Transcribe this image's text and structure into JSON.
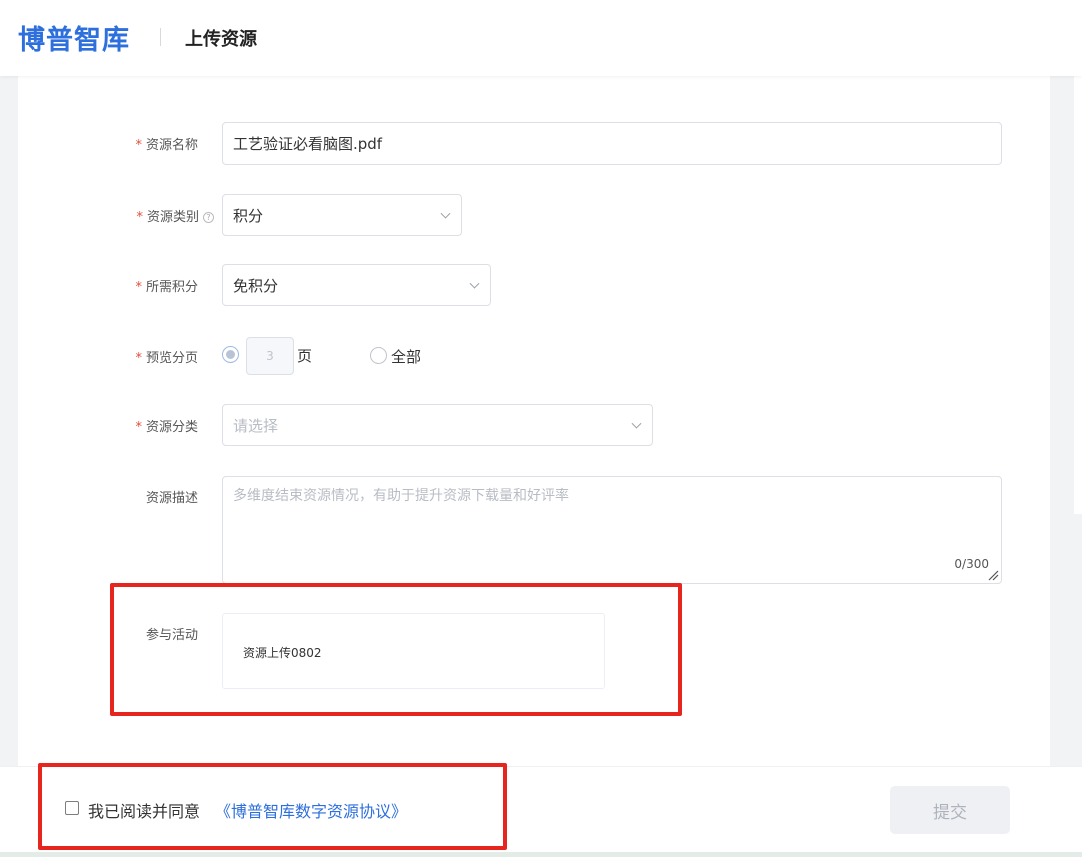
{
  "header": {
    "logo": "博普智库",
    "title": "上传资源"
  },
  "form": {
    "name": {
      "label": "资源名称",
      "value": "工艺验证必看脑图.pdf"
    },
    "category": {
      "label": "资源类别",
      "help_icon": "?",
      "value": "积分"
    },
    "points": {
      "label": "所需积分",
      "value": "免积分"
    },
    "preview": {
      "label": "预览分页",
      "pages_value": "3",
      "pages_unit": "页",
      "all_label": "全部",
      "selected": "pages"
    },
    "classification": {
      "label": "资源分类",
      "placeholder": "请选择"
    },
    "description": {
      "label": "资源描述",
      "placeholder": "多维度结束资源情况，有助于提升资源下载量和好评率",
      "count": "0/300"
    },
    "activity": {
      "label": "参与活动",
      "value": "资源上传0802"
    }
  },
  "footer": {
    "agree_text": "我已阅读并同意",
    "agreement_link": "《博普智库数字资源协议》",
    "submit_label": "提交",
    "agreed": false
  },
  "colors": {
    "brand": "#2d6fdc",
    "required": "#e34d3a",
    "highlight": "#e5251e"
  }
}
